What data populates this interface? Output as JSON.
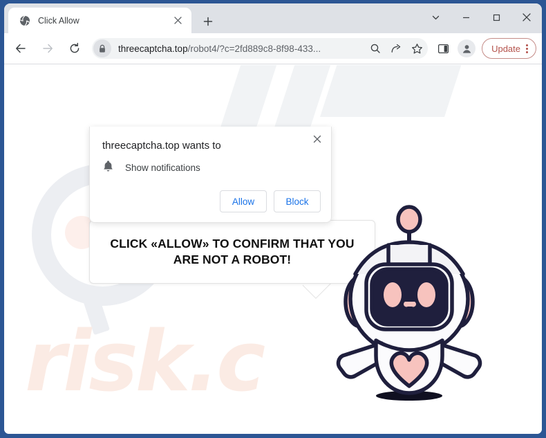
{
  "browser": {
    "tab": {
      "title": "Click Allow",
      "favicon": "globe-icon",
      "close": "×"
    },
    "newtab_label": "+",
    "window_controls": {
      "chevron": "chevron-down-icon",
      "minimize": "minimize-icon",
      "maximize": "maximize-icon",
      "close": "close-icon"
    },
    "toolbar": {
      "back": "back-arrow-icon",
      "forward": "forward-arrow-icon",
      "reload": "reload-icon",
      "lock": "lock-icon",
      "url_host": "threecaptcha.top",
      "url_path": "/robot4/?c=2fd889c8-8f98-433...",
      "zoom_search": "search-icon",
      "share": "share-icon",
      "bookmark": "star-icon",
      "side_panel": "side-panel-icon",
      "profile": "avatar-icon",
      "update_label": "Update",
      "menu": "kebab-menu-icon"
    }
  },
  "notification": {
    "title": "threecaptcha.top wants to",
    "permission_icon": "bell-icon",
    "permission_label": "Show notifications",
    "allow_label": "Allow",
    "block_label": "Block",
    "close_label": "×"
  },
  "page": {
    "bubble_line1": "CLICK «ALLOW» TO CONFIRM THAT YOU",
    "bubble_line2": "ARE NOT A ROBOT!",
    "watermark_text": "risk.c",
    "mascot": "robot-mascot"
  },
  "colors": {
    "window_frame": "#2c5694",
    "tabstrip": "#dee1e6",
    "omnibox": "#f1f3f4",
    "link_blue": "#1a73e8",
    "update_red": "#b4534c",
    "robot_outline": "#1f1f3d",
    "robot_pink": "#f7c3be",
    "watermark_pink": "#fbebe4"
  }
}
